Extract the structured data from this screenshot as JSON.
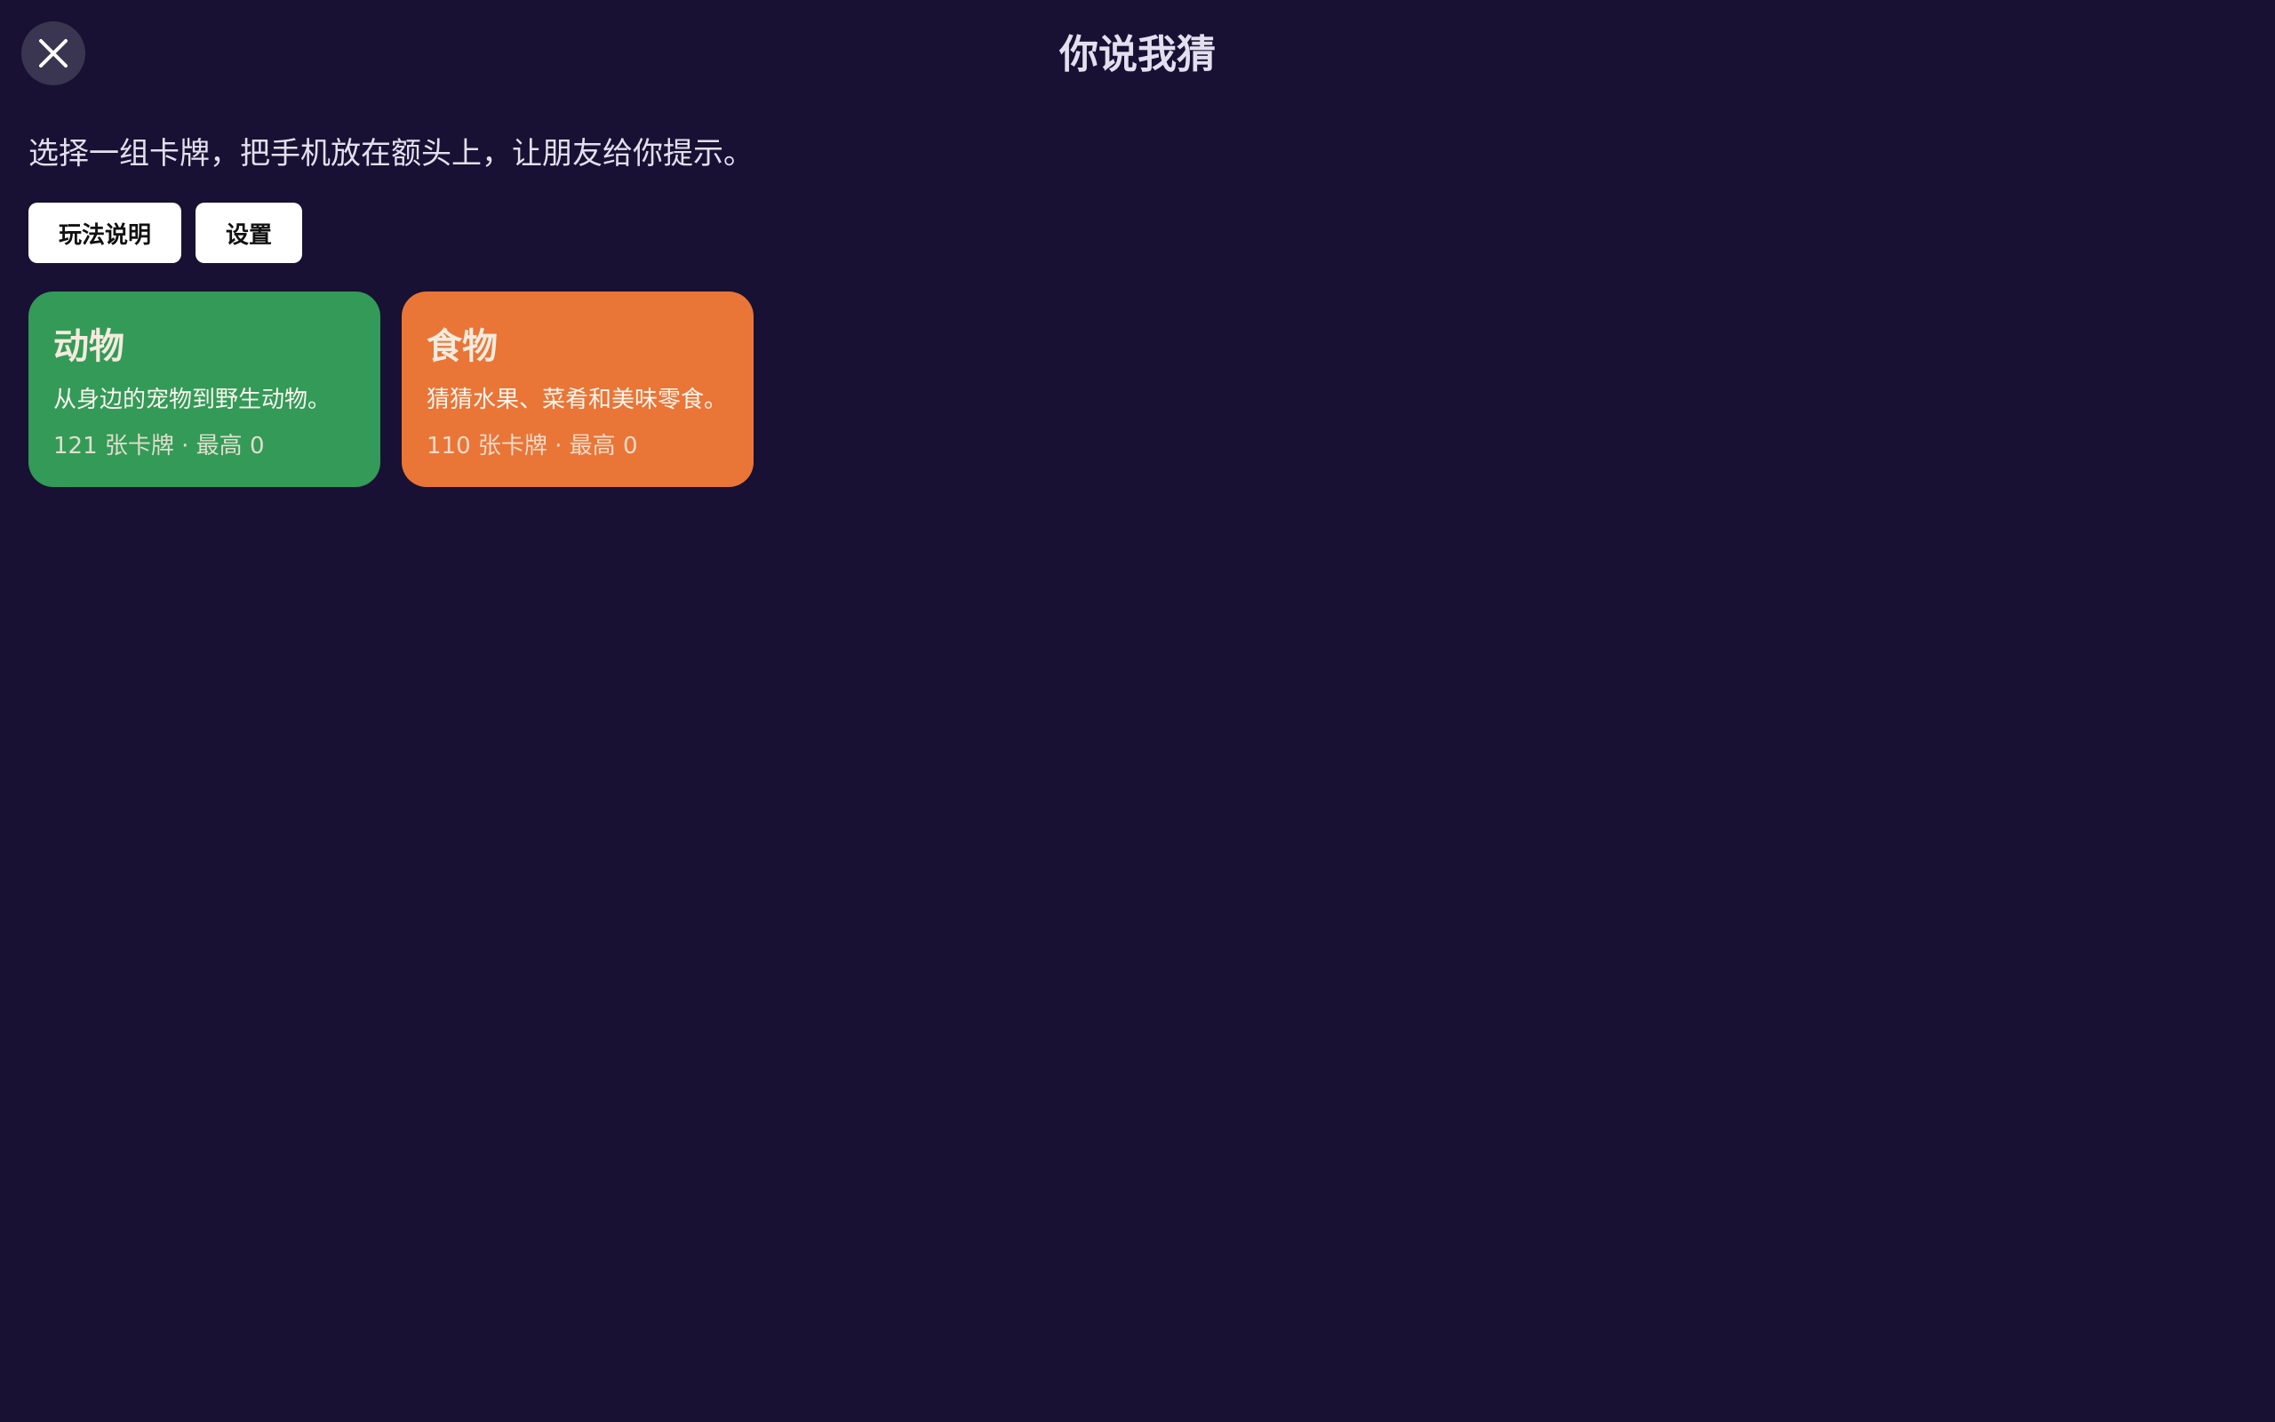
{
  "header": {
    "title": "你说我猜",
    "close_icon": "close-icon"
  },
  "intro": {
    "text": "选择一组卡牌，把手机放在额头上，让朋友给你提示。"
  },
  "buttons": {
    "how_to_play": "玩法说明",
    "settings": "设置"
  },
  "decks": [
    {
      "title": "动物",
      "description": "从身边的宠物到野生动物。",
      "meta": "121 张卡牌 · 最高 0",
      "color": "#339a58"
    },
    {
      "title": "食物",
      "description": "猜猜水果、菜肴和美味零食。",
      "meta": "110 张卡牌 · 最高 0",
      "color": "#e97537"
    }
  ],
  "colors": {
    "background": "#181133",
    "close_button_bg": "#3a3550"
  }
}
